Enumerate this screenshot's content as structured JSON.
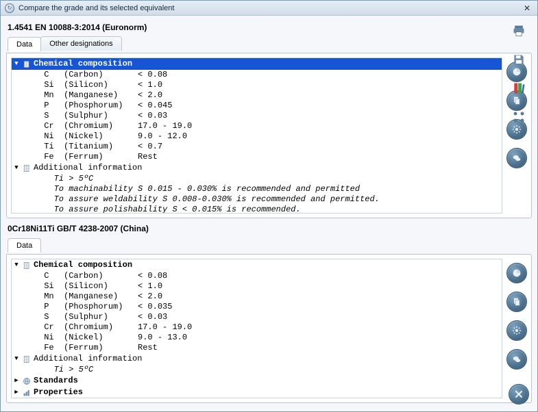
{
  "window": {
    "title": "Compare the grade and its selected equivalent"
  },
  "top": {
    "header": "1.4541 EN 10088-3:2014 (Euronorm)",
    "tabs": [
      "Data",
      "Other designations"
    ],
    "section_title": "Chemical composition",
    "rows": [
      {
        "sym": "C ",
        "name": "(Carbon)     ",
        "val": "< 0.08"
      },
      {
        "sym": "Si",
        "name": "(Silicon)    ",
        "val": "< 1.0"
      },
      {
        "sym": "Mn",
        "name": "(Manganese)  ",
        "val": "< 2.0"
      },
      {
        "sym": "P ",
        "name": "(Phosphorum) ",
        "val": "< 0.045"
      },
      {
        "sym": "S ",
        "name": "(Sulphur)    ",
        "val": "< 0.03"
      },
      {
        "sym": "Cr",
        "name": "(Chromium)   ",
        "val": "17.0 - 19.0"
      },
      {
        "sym": "Ni",
        "name": "(Nickel)     ",
        "val": "9.0 - 12.0"
      },
      {
        "sym": "Ti",
        "name": "(Titanium)   ",
        "val": "< 0.7"
      },
      {
        "sym": "Fe",
        "name": "(Ferrum)     ",
        "val": "Rest"
      }
    ],
    "additional_header": "Additional information",
    "additional": [
      "Ti > 5ºC",
      "To machinability S 0.015 - 0.030% is recommended and permitted",
      "To assure weldability S 0.008-0.030% is recommended and permitted.",
      "To assure polishability S < 0.015% is recommended."
    ]
  },
  "bottom": {
    "header": "0Cr18Ni11Ti GB/T 4238-2007 (China)",
    "tabs": [
      "Data"
    ],
    "section_title": "Chemical composition",
    "rows": [
      {
        "sym": "C ",
        "name": "(Carbon)     ",
        "val": "< 0.08"
      },
      {
        "sym": "Si",
        "name": "(Silicon)    ",
        "val": "< 1.0"
      },
      {
        "sym": "Mn",
        "name": "(Manganese)  ",
        "val": "< 2.0"
      },
      {
        "sym": "P ",
        "name": "(Phosphorum) ",
        "val": "< 0.035"
      },
      {
        "sym": "S ",
        "name": "(Sulphur)    ",
        "val": "< 0.03"
      },
      {
        "sym": "Cr",
        "name": "(Chromium)   ",
        "val": "17.0 - 19.0"
      },
      {
        "sym": "Ni",
        "name": "(Nickel)     ",
        "val": "9.0 - 13.0"
      },
      {
        "sym": "Fe",
        "name": "(Ferrum)     ",
        "val": "Rest"
      }
    ],
    "additional_header": "Additional information",
    "additional": [
      "Ti > 5ºC"
    ],
    "collapsed": [
      "Standards",
      "Properties"
    ]
  },
  "rail": {
    "items": [
      "print",
      "save",
      "book",
      "fullscreen"
    ]
  }
}
